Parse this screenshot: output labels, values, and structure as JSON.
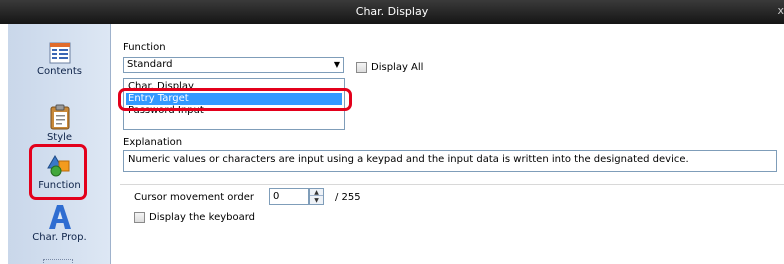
{
  "window": {
    "title": "Char. Display",
    "close_glyph": "x"
  },
  "sidebar": {
    "items": [
      {
        "label": "Contents",
        "icon": "contents-icon"
      },
      {
        "label": "Style",
        "icon": "clipboard-icon"
      },
      {
        "label": "Function",
        "icon": "shapes-icon",
        "selected": true
      },
      {
        "label": "Char. Prop.",
        "icon": "letter-a-icon"
      }
    ]
  },
  "function": {
    "label": "Function",
    "selected": "Standard",
    "display_all_label": "Display All",
    "options": [
      "Char. Display",
      "Entry Target",
      "Password Input"
    ],
    "selected_option": "Entry Target"
  },
  "explanation": {
    "label": "Explanation",
    "text": "Numeric values or characters are input using a keypad and the input data is written into the designated device."
  },
  "cursor": {
    "label": "Cursor movement order",
    "value": "0",
    "max_text": "/ 255"
  },
  "keyboard": {
    "label": "Display the keyboard"
  },
  "colors": {
    "highlight": "#e3001b",
    "selection": "#3399ff",
    "sidebar": "#d3dfee"
  }
}
